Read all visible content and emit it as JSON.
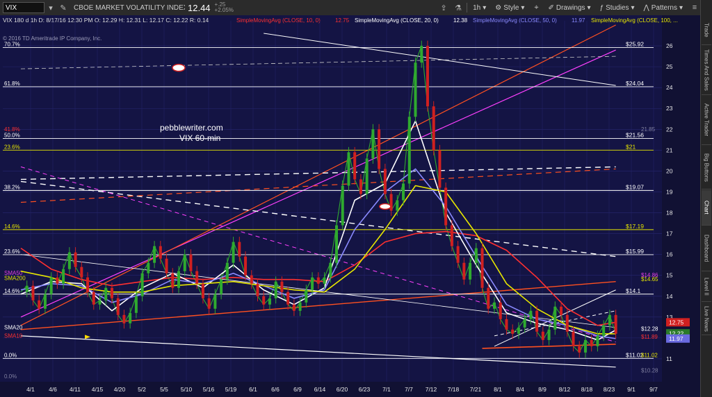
{
  "toolbar": {
    "symbol": "VIX",
    "name": "CBOE MARKET VOLATILITY INDEX",
    "last": "12.44",
    "change": "+.25",
    "change_pct": "+2.05%",
    "timeframe": "1h",
    "style_label": "Style",
    "drawings_label": "Drawings",
    "studies_label": "Studies",
    "patterns_label": "Patterns"
  },
  "sidebar": {
    "tabs": [
      "Trade",
      "Times And Sales",
      "Active Trader",
      "Big Buttons",
      "Chart",
      "Dashboard",
      "Level II",
      "Live News"
    ],
    "active": "Chart"
  },
  "chart_data": {
    "type": "line",
    "header": "VIX 180 d 1h   D: 8/17/16 12:30 PM   O: 12.29   H: 12.31   L: 12.17   C: 12.22   R: 0.14",
    "copyright": "© 2016 TD Ameritrade IP Company, Inc.",
    "watermark": [
      "pebblewriter.com",
      "VIX 60-min"
    ],
    "y_range": [
      9.9,
      27.2
    ],
    "y_ticks": [
      11,
      12,
      13,
      14,
      15,
      16,
      17,
      18,
      19,
      20,
      21,
      22,
      23,
      24,
      25,
      26
    ],
    "x_ticks": [
      "4/1",
      "4/6",
      "4/11",
      "4/15",
      "4/20",
      "5/2",
      "5/5",
      "5/10",
      "5/16",
      "5/19",
      "6/1",
      "6/6",
      "6/9",
      "6/14",
      "6/20",
      "6/23",
      "7/1",
      "7/7",
      "7/12",
      "7/18",
      "7/21",
      "8/1",
      "8/4",
      "8/9",
      "8/12",
      "8/18",
      "8/23",
      "9/1",
      "9/7"
    ],
    "studies": [
      {
        "label": "SimpleMovingAvg (CLOSE, 10, 0)",
        "value": "12.75",
        "color": "#ff3030"
      },
      {
        "label": "SimpleMovingAvg (CLOSE, 20, 0)",
        "value": "12.38",
        "color": "#ffffff"
      },
      {
        "label": "SimpleMovingAvg (CLOSE, 50, 0)",
        "value": "11.97",
        "color": "#8a8aff"
      },
      {
        "label": "SimpleMovingAvg (CLOSE, 100, ...",
        "value": "",
        "color": "#e6e600"
      }
    ],
    "fib_levels": [
      {
        "pct": "70.7%",
        "value": 25.92,
        "label": "$25.92",
        "color": "#ffffff"
      },
      {
        "pct": "61.8%",
        "value": 24.04,
        "label": "$24.04",
        "color": "#ffffff"
      },
      {
        "pct": "50.0%",
        "value": 21.56,
        "label": "$21.56",
        "color": "#ffffff"
      },
      {
        "pct": "23.6%",
        "value": 21.0,
        "label": "$21",
        "color": "#e6e600"
      },
      {
        "pct": "38.2%",
        "value": 19.07,
        "label": "$19.07",
        "color": "#ffffff"
      },
      {
        "pct": "14.6%",
        "value": 17.19,
        "label": "$17.19",
        "color": "#e6e600"
      },
      {
        "pct": "23.6%",
        "value": 15.99,
        "label": "$15.99",
        "color": "#ffffff"
      },
      {
        "pct": "14.6%",
        "value": 14.1,
        "label": "$14.1",
        "color": "#ffffff"
      },
      {
        "pct": "0.0%",
        "value": 11.02,
        "label": "$11.02",
        "color": "#ffffff"
      }
    ],
    "extra_labels": [
      {
        "text": "21.85",
        "value": 21.85,
        "color": "#8080a0"
      },
      {
        "text": "SMA50",
        "value": 14.96,
        "color": "#e040e0"
      },
      {
        "text": "SMA200",
        "value": 14.7,
        "color": "#e6e600"
      },
      {
        "text": "SMA20",
        "value": 12.35,
        "color": "#ffffff"
      },
      {
        "text": "SMA10",
        "value": 11.95,
        "color": "#ff3030"
      },
      {
        "text": "$14.86",
        "value": 14.86,
        "color": "#e040e0"
      },
      {
        "text": "$14.65",
        "value": 14.65,
        "color": "#e6e600"
      },
      {
        "text": "$12.28",
        "value": 12.28,
        "color": "#ffffff"
      },
      {
        "text": "$11.89",
        "value": 11.89,
        "color": "#ff3030"
      },
      {
        "text": "$11.02",
        "value": 11.02,
        "color": "#e6e600"
      },
      {
        "text": "$10.28",
        "value": 10.28,
        "color": "#8080a0"
      },
      {
        "text": "0.0%",
        "value": 10.0,
        "color": "#8080a0"
      },
      {
        "text": "41.8%",
        "value": 21.85,
        "color": "#ff3030"
      }
    ],
    "price_tags": [
      {
        "text": "12.75",
        "value": 12.75,
        "color": "#d02020"
      },
      {
        "text": "12.22",
        "value": 12.22,
        "color": "#2a7a2a"
      },
      {
        "text": "11.97",
        "value": 11.97,
        "color": "#6a6ae0"
      }
    ],
    "series": [
      {
        "name": "VIX",
        "color": "#2faa2f",
        "x": [
          0,
          1,
          2,
          3,
          4,
          5,
          6,
          7,
          8,
          9,
          10,
          11,
          12,
          13,
          14,
          15,
          16,
          17,
          18,
          19,
          20,
          21,
          22,
          23,
          24,
          25,
          26,
          27,
          28,
          29,
          30,
          31,
          32,
          33,
          34,
          35,
          36,
          37,
          38,
          39,
          40,
          41,
          42,
          43,
          44,
          45,
          46,
          47,
          48,
          49,
          50,
          51,
          52,
          53,
          54,
          55,
          56,
          57,
          58,
          59,
          60,
          61,
          62,
          63,
          64,
          65,
          66,
          67,
          68,
          69,
          70,
          71,
          72,
          73,
          74,
          75,
          76,
          77,
          78,
          79,
          80,
          81,
          82,
          83,
          84,
          85,
          86,
          87,
          88,
          89,
          90,
          91,
          92,
          93,
          94,
          95,
          96,
          97,
          98
        ],
        "values": [
          14.2,
          14.5,
          13.8,
          13.4,
          14.1,
          14.9,
          14.6,
          15.3,
          16.1,
          15.4,
          14.9,
          14.2,
          13.6,
          13.8,
          14.4,
          13.9,
          13.1,
          12.7,
          13.2,
          14.0,
          15.1,
          15.6,
          16.4,
          15.8,
          15.1,
          14.4,
          15.2,
          16.0,
          15.2,
          14.6,
          13.9,
          13.4,
          14.1,
          14.8,
          15.6,
          16.6,
          15.9,
          15.0,
          14.6,
          14.0,
          13.6,
          13.9,
          14.7,
          14.2,
          13.6,
          13.3,
          13.7,
          14.3,
          14.9,
          14.6,
          14.9,
          15.6,
          17.4,
          19.3,
          20.9,
          19.6,
          18.9,
          20.6,
          22.0,
          20.1,
          18.9,
          18.1,
          18.6,
          19.4,
          22.6,
          25.2,
          26.0,
          23.1,
          21.0,
          19.2,
          17.4,
          16.4,
          15.6,
          14.8,
          15.6,
          16.3,
          14.4,
          13.4,
          13.7,
          12.9,
          12.4,
          12.2,
          12.5,
          12.9,
          13.3,
          12.3,
          11.9,
          12.4,
          13.5,
          13.1,
          12.3,
          11.6,
          11.3,
          11.9,
          11.6,
          12.1,
          12.6,
          13.1,
          12.2
        ]
      },
      {
        "name": "SMA10",
        "color": "#ff3030",
        "x": [
          0,
          5,
          10,
          15,
          20,
          25,
          30,
          35,
          40,
          45,
          50,
          55,
          60,
          65,
          70,
          75,
          80,
          85,
          90,
          95,
          98
        ],
        "values": [
          16.3,
          15.3,
          14.8,
          14.5,
          14.7,
          14.9,
          14.8,
          14.9,
          14.8,
          14.8,
          14.7,
          15.5,
          16.6,
          17.0,
          17.1,
          16.9,
          16.2,
          14.9,
          13.4,
          12.6,
          12.75
        ]
      },
      {
        "name": "SMA20",
        "color": "#ffffff",
        "x": [
          0,
          5,
          10,
          15,
          20,
          25,
          30,
          35,
          40,
          45,
          50,
          55,
          60,
          65,
          70,
          75,
          80,
          85,
          90,
          95,
          98
        ],
        "values": [
          14.1,
          14.7,
          14.6,
          13.3,
          14.4,
          15.1,
          14.4,
          15.5,
          14.3,
          13.6,
          14.4,
          18.6,
          19.4,
          22.4,
          18.0,
          15.5,
          13.2,
          12.7,
          12.4,
          11.9,
          12.38
        ]
      },
      {
        "name": "SMA50",
        "color": "#8a8aff",
        "x": [
          0,
          5,
          10,
          15,
          20,
          25,
          30,
          35,
          40,
          45,
          50,
          55,
          60,
          65,
          70,
          75,
          80,
          85,
          90,
          95,
          98
        ],
        "values": [
          14.3,
          14.6,
          14.5,
          13.7,
          14.1,
          14.8,
          14.6,
          15.1,
          14.5,
          13.9,
          14.3,
          17.2,
          19.0,
          20.1,
          18.3,
          15.9,
          13.6,
          12.9,
          12.6,
          12.1,
          11.97
        ]
      },
      {
        "name": "SMA100",
        "color": "#e6e600",
        "x": [
          0,
          5,
          10,
          15,
          20,
          25,
          30,
          35,
          40,
          45,
          50,
          55,
          60,
          65,
          70,
          75,
          80,
          85,
          90,
          95,
          98
        ],
        "values": [
          15.2,
          14.9,
          14.4,
          14.2,
          14.2,
          14.5,
          14.6,
          14.7,
          14.5,
          14.3,
          14.2,
          15.3,
          17.2,
          19.3,
          19.0,
          17.0,
          14.6,
          13.4,
          12.6,
          12.2,
          12.2
        ]
      }
    ],
    "x_max": 104,
    "grid": true
  }
}
